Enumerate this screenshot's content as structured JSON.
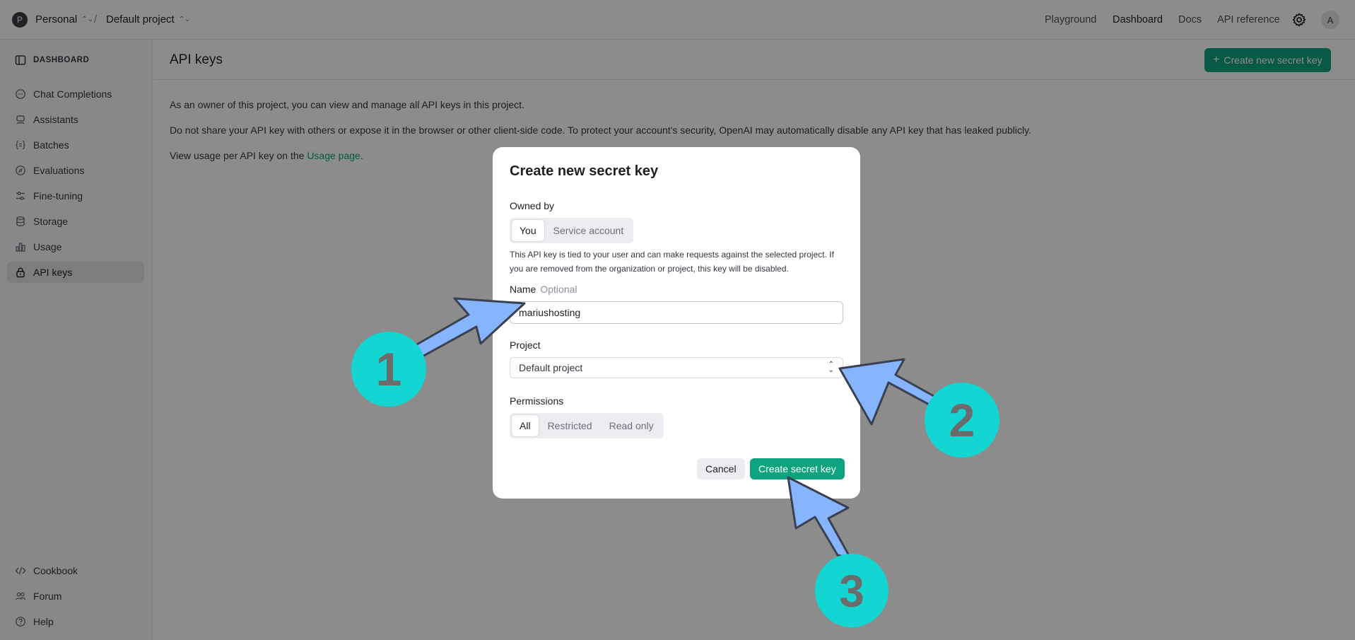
{
  "topbar": {
    "org_initial": "P",
    "org_name": "Personal",
    "separator": "/",
    "project_name": "Default project",
    "nav": [
      "Playground",
      "Dashboard",
      "Docs",
      "API reference"
    ],
    "user_initial": "A"
  },
  "sidebar": {
    "heading": "DASHBOARD",
    "items": [
      {
        "label": "Chat Completions",
        "icon": "chat-icon"
      },
      {
        "label": "Assistants",
        "icon": "assistant-icon"
      },
      {
        "label": "Batches",
        "icon": "batches-icon"
      },
      {
        "label": "Evaluations",
        "icon": "evaluations-icon"
      },
      {
        "label": "Fine-tuning",
        "icon": "sliders-icon"
      },
      {
        "label": "Storage",
        "icon": "database-icon"
      },
      {
        "label": "Usage",
        "icon": "bar-chart-icon"
      },
      {
        "label": "API keys",
        "icon": "lock-icon",
        "active": true
      }
    ],
    "footer": [
      {
        "label": "Cookbook",
        "icon": "code-icon"
      },
      {
        "label": "Forum",
        "icon": "people-icon"
      },
      {
        "label": "Help",
        "icon": "help-icon"
      }
    ]
  },
  "main": {
    "title": "API keys",
    "create_button": "Create new secret key",
    "para1": "As an owner of this project, you can view and manage all API keys in this project.",
    "para2": "Do not share your API key with others or expose it in the browser or other client-side code. To protect your account's security, OpenAI may automatically disable any API key that has leaked publicly.",
    "para3_prefix": "View usage per API key on the ",
    "para3_link": "Usage page",
    "para3_suffix": "."
  },
  "modal": {
    "title": "Create new secret key",
    "owned_by_label": "Owned by",
    "owned_by_options": [
      "You",
      "Service account"
    ],
    "owned_by_selected": "You",
    "help_text": "This API key is tied to your user and can make requests against the selected project. If you are removed from the organization or project, this key will be disabled.",
    "name_label": "Name",
    "name_optional": "Optional",
    "name_value": "mariushosting",
    "project_label": "Project",
    "project_value": "Default project",
    "permissions_label": "Permissions",
    "permissions_options": [
      "All",
      "Restricted",
      "Read only"
    ],
    "permissions_selected": "All",
    "cancel_button": "Cancel",
    "create_button": "Create secret key"
  },
  "annotations": {
    "step1": "1",
    "step2": "2",
    "step3": "3",
    "arrow_color": "#86b4ff",
    "circle_color": "#13d6d2",
    "number_color": "#6b6b6b"
  },
  "colors": {
    "accent": "#10a37f"
  }
}
